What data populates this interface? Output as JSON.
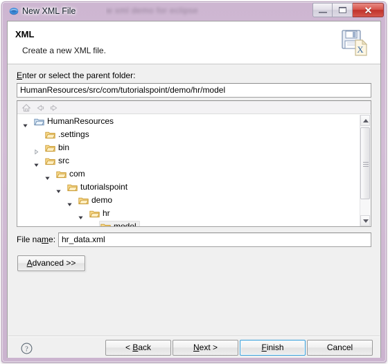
{
  "window": {
    "title": "New XML File",
    "icon": "eclipse-wizard-icon",
    "background_bleed_text": "w xml demo for eclipse",
    "controls": {
      "minimize_label": "",
      "maximize_label": "",
      "close_label": "✕"
    }
  },
  "header": {
    "title": "XML",
    "subtitle": "Create a new XML file.",
    "icon": "xml-file-save-icon"
  },
  "form": {
    "parent_folder_label": "Enter or select the parent folder:",
    "parent_folder_label_mnemonic": "E",
    "parent_folder_value": "HumanResources/src/com/tutorialspoint/demo/hr/model",
    "file_name_label": "File name:",
    "file_name_label_mnemonic": "m",
    "file_name_value": "hr_data.xml",
    "advanced_button": "Advanced >>"
  },
  "tree_toolbar": {
    "home_icon": "home-icon",
    "back_icon": "back-arrow-icon",
    "forward_icon": "forward-arrow-icon"
  },
  "tree": {
    "rows": [
      {
        "label": "HumanResources",
        "depth": 0,
        "expander": "expanded",
        "icon": "project-folder-icon",
        "selected": false
      },
      {
        "label": ".settings",
        "depth": 1,
        "expander": "none",
        "icon": "folder-icon",
        "selected": false
      },
      {
        "label": "bin",
        "depth": 1,
        "expander": "collapsed",
        "icon": "folder-icon",
        "selected": false
      },
      {
        "label": "src",
        "depth": 1,
        "expander": "expanded",
        "icon": "folder-icon",
        "selected": false
      },
      {
        "label": "com",
        "depth": 2,
        "expander": "expanded",
        "icon": "folder-icon",
        "selected": false
      },
      {
        "label": "tutorialspoint",
        "depth": 3,
        "expander": "expanded",
        "icon": "folder-icon",
        "selected": false
      },
      {
        "label": "demo",
        "depth": 4,
        "expander": "expanded",
        "icon": "folder-icon",
        "selected": false
      },
      {
        "label": "hr",
        "depth": 5,
        "expander": "expanded",
        "icon": "folder-icon",
        "selected": false
      },
      {
        "label": "model",
        "depth": 6,
        "expander": "none",
        "icon": "folder-icon",
        "selected": true
      },
      {
        "label": "",
        "depth": 6,
        "expander": "none",
        "icon": "folder-icon",
        "selected": false
      }
    ],
    "scrollbar": {
      "position": "middle"
    }
  },
  "footer": {
    "help_icon": "help-question-icon",
    "buttons": [
      {
        "label": "< Back",
        "mnemonic": "B",
        "default": false,
        "enabled": true
      },
      {
        "label": "Next >",
        "mnemonic": "N",
        "default": false,
        "enabled": true
      },
      {
        "label": "Finish",
        "mnemonic": "F",
        "default": true,
        "enabled": true
      },
      {
        "label": "Cancel",
        "mnemonic": "",
        "default": false,
        "enabled": true
      }
    ]
  },
  "colors": {
    "titlebar": "#cbb4cf",
    "frame_border": "#b9a2bd",
    "dialog_bg": "#f0f0f0",
    "header_bg": "#ffffff",
    "default_button_focus": "#3c9fd8",
    "close_button": "#c0322b",
    "folder_icon": "#f0b94a",
    "selection_bg": "#efefef"
  }
}
